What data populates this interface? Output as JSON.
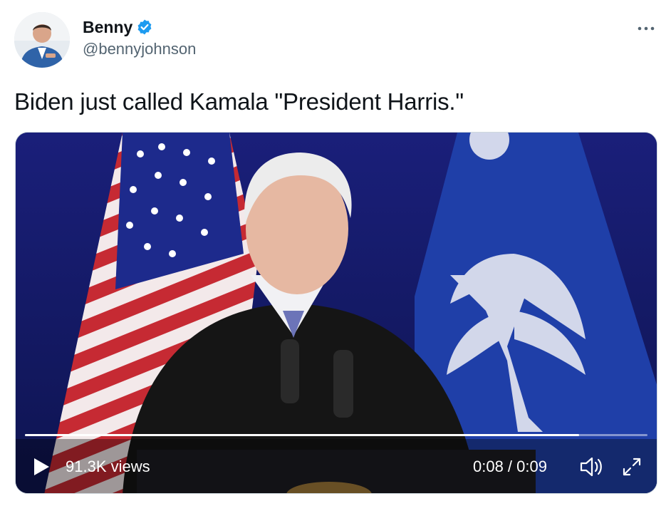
{
  "author": {
    "display_name": "Benny",
    "handle": "@bennyjohnson",
    "verified": true,
    "avatar_icon": "profile-photo"
  },
  "tweet": {
    "text": "Biden just called Kamala \"President Harris.\""
  },
  "video": {
    "views": "91.3K views",
    "time": "0:08 / 0:09",
    "progress": 0.89
  },
  "colors": {
    "verified": "#1d9bf0",
    "handle": "#536471",
    "text": "#0f1419",
    "video_bg": "#121a66"
  }
}
